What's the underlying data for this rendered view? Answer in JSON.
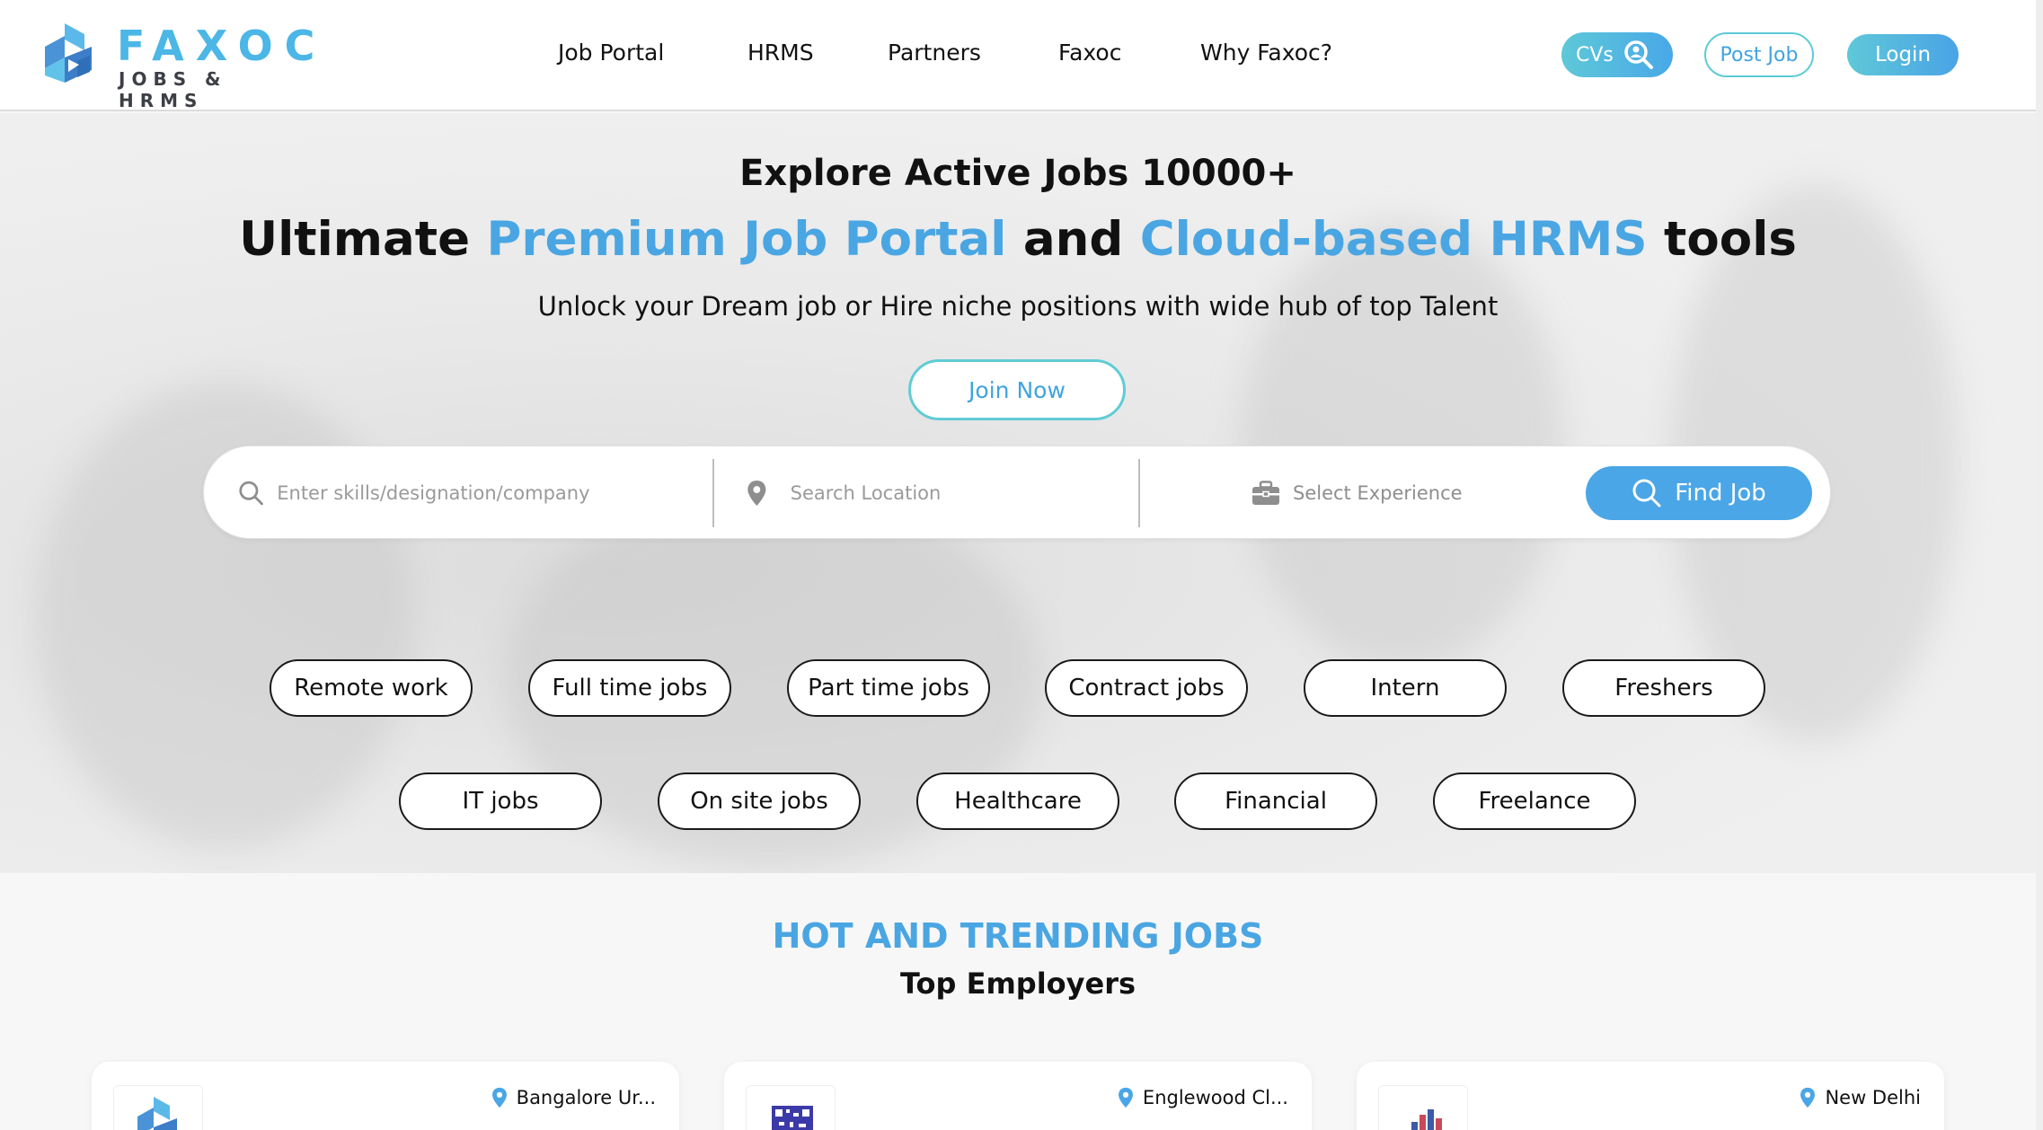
{
  "brand": {
    "name": "FAXOC",
    "tagline": "JOBS & HRMS"
  },
  "nav": {
    "items": [
      "Job Portal",
      "HRMS",
      "Partners",
      "Faxoc",
      "Why Faxoc?"
    ]
  },
  "header_actions": {
    "cvs": "CVs",
    "post_job": "Post Job",
    "login": "Login"
  },
  "hero": {
    "headline": "Explore Active Jobs 10000+",
    "title_part1": "Ultimate ",
    "title_highlight1": "Premium Job Portal",
    "title_part2": " and ",
    "title_highlight2": "Cloud-based HRMS",
    "title_part3": " tools",
    "subtitle": "Unlock your Dream job or Hire niche positions with wide hub of top Talent",
    "join_button": "Join Now"
  },
  "search": {
    "skills_placeholder": "Enter skills/designation/company",
    "location_placeholder": "Search Location",
    "experience_label": "Select Experience",
    "find_button": "Find Job"
  },
  "categories_row1": [
    "Remote work",
    "Full time jobs",
    "Part time jobs",
    "Contract jobs",
    "Intern",
    "Freshers"
  ],
  "categories_row2": [
    "IT jobs",
    "On site jobs",
    "Healthcare",
    "Financial",
    "Freelance"
  ],
  "section": {
    "title": "HOT AND TRENDING JOBS",
    "subtitle": "Top Employers"
  },
  "employers": [
    {
      "location": "Bangalore Ur..."
    },
    {
      "location": "Englewood Cl..."
    },
    {
      "location": "New Delhi"
    }
  ],
  "colors": {
    "accent": "#4aa6e2",
    "teal": "#5ccbd6"
  },
  "icons": [
    "search-icon",
    "location-pin-icon",
    "briefcase-icon",
    "cv-search-icon"
  ]
}
